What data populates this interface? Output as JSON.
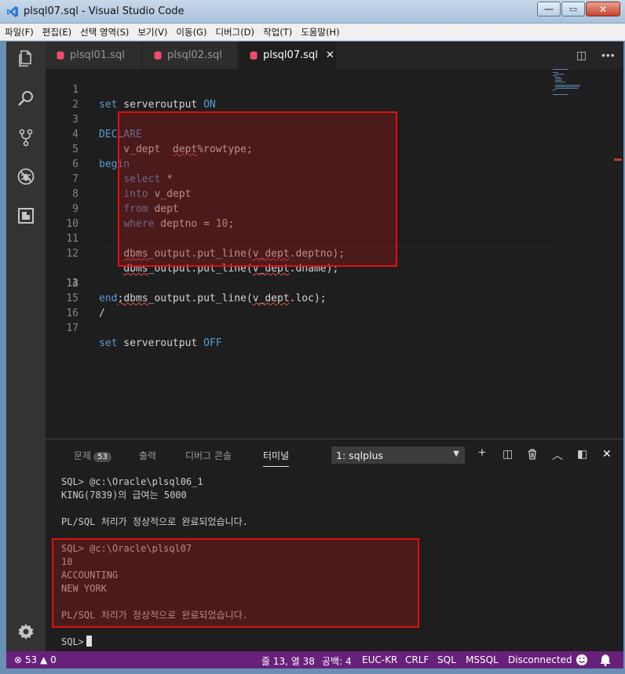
{
  "window": {
    "title": "plsql07.sql - Visual Studio Code"
  },
  "menu": [
    "파일(F)",
    "편집(E)",
    "선택 영역(S)",
    "보기(V)",
    "이동(G)",
    "디버그(D)",
    "작업(T)",
    "도움말(H)"
  ],
  "tabs": [
    {
      "label": "plsql01.sql",
      "active": false
    },
    {
      "label": "plsql02.sql",
      "active": false
    },
    {
      "label": "plsql07.sql",
      "active": true
    }
  ],
  "tab_close_glyph": "✕",
  "editor": {
    "current_line": 13,
    "lines": [
      {
        "n": "1",
        "text": "set serveroutput ON"
      },
      {
        "n": "2",
        "text": ""
      },
      {
        "n": "3",
        "text": "DECLARE"
      },
      {
        "n": "4",
        "text": "    v_dept  dept%rowtype;"
      },
      {
        "n": "5",
        "text": "begin"
      },
      {
        "n": "6",
        "text": "    select *"
      },
      {
        "n": "7",
        "text": "    into v_dept"
      },
      {
        "n": "8",
        "text": "    from dept"
      },
      {
        "n": "9",
        "text": "    where deptno = 10;"
      },
      {
        "n": "10",
        "text": ""
      },
      {
        "n": "11",
        "text": "    dbms_output.put_line(v_dept.deptno);"
      },
      {
        "n": "12",
        "text": "    dbms_output.put_line(v_dept.dname);"
      },
      {
        "n": "13",
        "text": "    dbms_output.put_line(v_dept.loc);"
      },
      {
        "n": "14",
        "text": "end;"
      },
      {
        "n": "15",
        "text": "/"
      },
      {
        "n": "16",
        "text": ""
      },
      {
        "n": "17",
        "text": "set serveroutput OFF"
      }
    ]
  },
  "panel": {
    "tabs": {
      "problems": "문제",
      "problems_count": "53",
      "output": "출력",
      "debug_console": "디버그 콘솔",
      "terminal": "터미널"
    },
    "terminal_select": "1: sqlplus",
    "terminal_lines": [
      "SQL> @c:\\Oracle\\plsql06_1",
      "KING(7839)의 급여는 5000",
      "",
      "PL/SQL 처리가 정상적으로 완료되었습니다.",
      "",
      "SQL> @c:\\Oracle\\plsql07",
      "10",
      "ACCOUNTING",
      "NEW YORK",
      "",
      "PL/SQL 처리가 정상적으로 완료되었습니다.",
      "",
      "SQL>"
    ]
  },
  "statusbar": {
    "errors": "53",
    "warnings": "0",
    "position": "줄 13, 열 38",
    "spaces": "공백: 4",
    "encoding": "EUC-KR",
    "eol": "CRLF",
    "language": "SQL",
    "connection_type": "MSSQL",
    "connection_status": "Disconnected"
  },
  "colors": {
    "statusbar": "#68217a",
    "highlight": "#e01010",
    "keyword": "#569cd6",
    "number": "#b5cea8"
  }
}
